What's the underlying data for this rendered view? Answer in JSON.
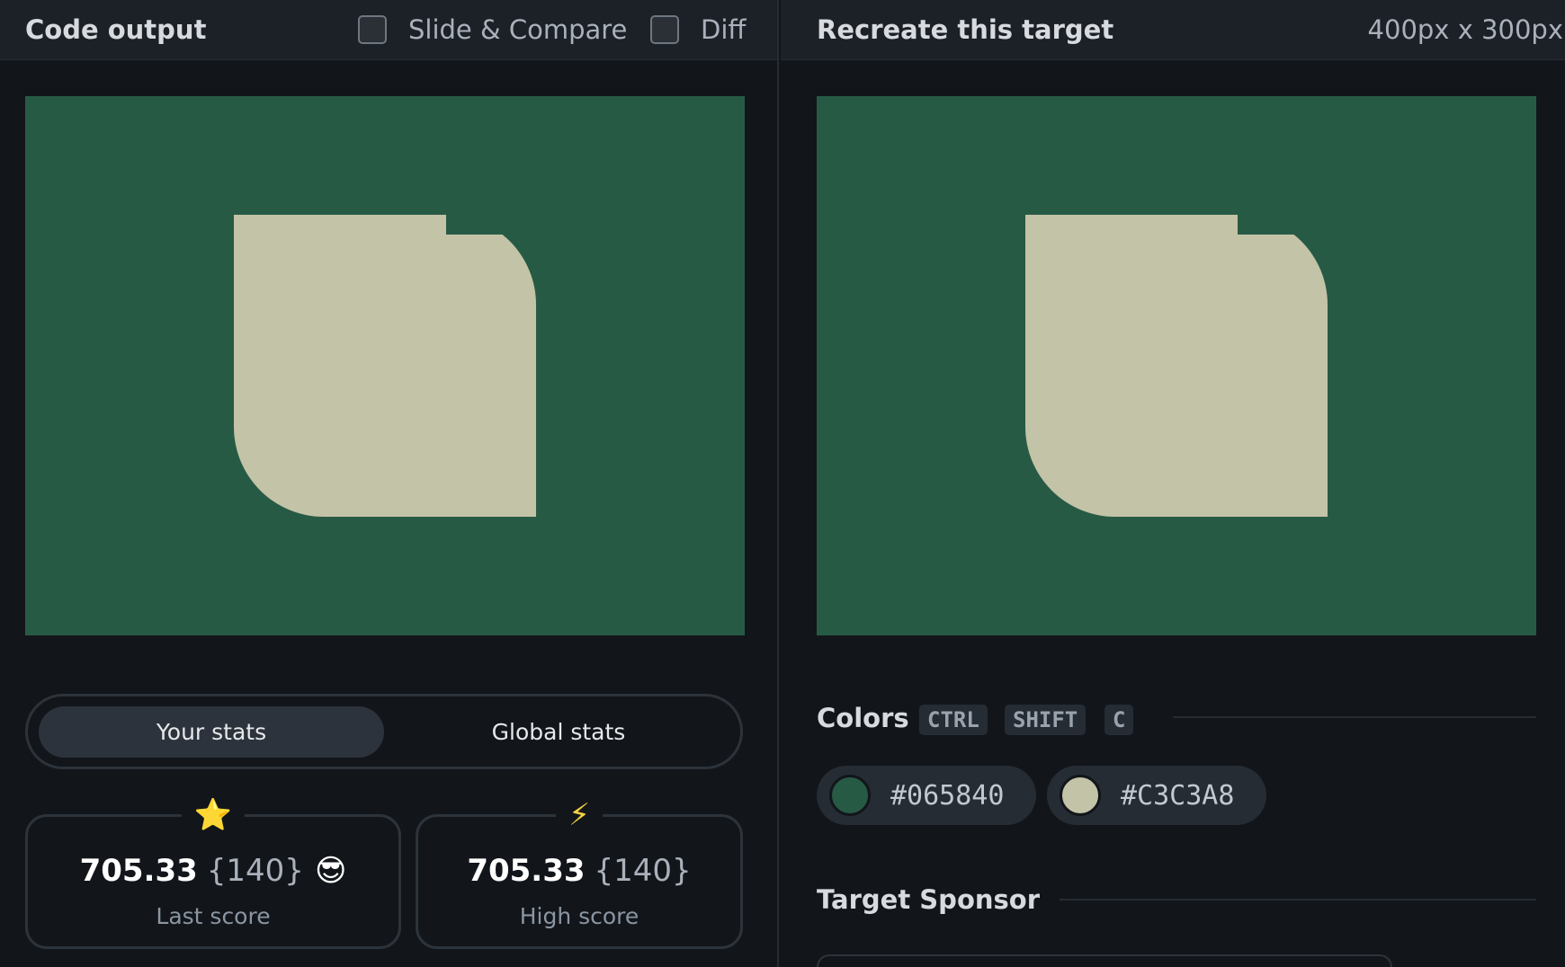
{
  "left_panel": {
    "title": "Code output",
    "slide_compare_label": "Slide & Compare",
    "diff_label": "Diff",
    "canvas_colors": {
      "background": "#275a44",
      "shape": "#c3c3a8"
    }
  },
  "right_panel": {
    "title": "Recreate this target",
    "dimensions": "400px x 300px"
  },
  "stats": {
    "tabs": {
      "active": "Your stats",
      "inactive": "Global stats"
    },
    "last": {
      "icon": "star-icon",
      "glyph": "⭐",
      "value": "705.33",
      "count": "{140}",
      "emoji": "😎",
      "label": "Last score"
    },
    "high": {
      "icon": "lightning-icon",
      "glyph": "⚡",
      "value": "705.33",
      "count": "{140}",
      "label": "High score"
    }
  },
  "colors": {
    "title": "Colors",
    "shortcut": [
      "CTRL",
      "SHIFT",
      "C"
    ],
    "swatches": [
      {
        "hex": "#065840",
        "display": "#065840",
        "swatch_color": "#275a44"
      },
      {
        "hex": "#C3C3A8",
        "display": "#C3C3A8",
        "swatch_color": "#c3c3a8"
      }
    ]
  },
  "sponsor": {
    "title": "Target Sponsor"
  }
}
